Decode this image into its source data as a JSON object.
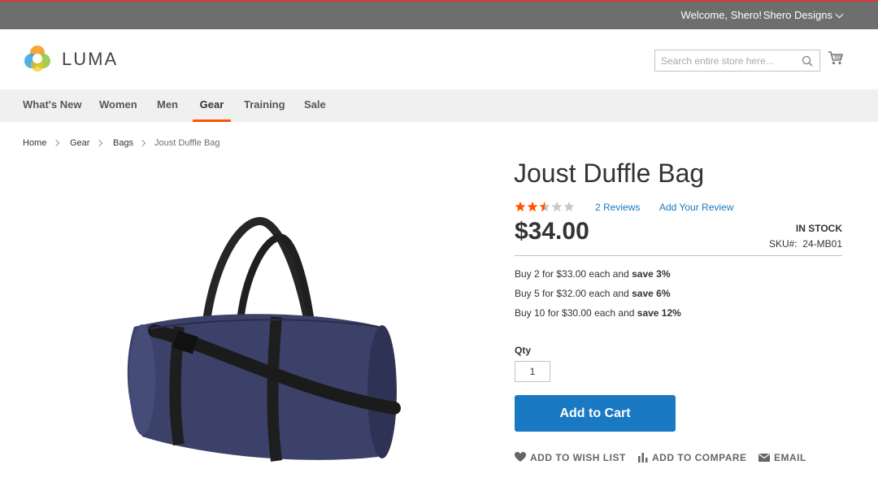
{
  "top_panel": {
    "welcome": "Welcome, Shero!",
    "account_name": "Shero Designs"
  },
  "header": {
    "logo_text": "LUMA",
    "search_placeholder": "Search entire store here...",
    "icons": [
      "search-icon",
      "cart-icon"
    ]
  },
  "nav": {
    "items": [
      {
        "label": "What's New"
      },
      {
        "label": "Women"
      },
      {
        "label": "Men"
      },
      {
        "label": "Gear",
        "active": true
      },
      {
        "label": "Training"
      },
      {
        "label": "Sale"
      }
    ]
  },
  "breadcrumb": [
    "Home",
    "Gear",
    "Bags",
    "Joust Duffle Bag"
  ],
  "product": {
    "name": "Joust Duffle Bag",
    "rating_stars": 2.5,
    "rating_max": 5,
    "reviews_label": "2 Reviews",
    "add_review_label": "Add Your Review",
    "price": "$34.00",
    "stock": "IN STOCK",
    "sku_label": "SKU#:",
    "sku": "24-MB01",
    "tier_prices": [
      {
        "text": "Buy 2 for $33.00 each and ",
        "save": "save 3%"
      },
      {
        "text": "Buy 5 for $32.00 each and ",
        "save": "save 6%"
      },
      {
        "text": "Buy 10 for $30.00 each and ",
        "save": "save 12%"
      }
    ],
    "qty_label": "Qty",
    "qty_value": "1",
    "add_to_cart_label": "Add to Cart",
    "actions": [
      {
        "label": "ADD TO WISH LIST",
        "icon": "heart-icon"
      },
      {
        "label": "ADD TO COMPARE",
        "icon": "compare-icon"
      },
      {
        "label": "EMAIL",
        "icon": "envelope-icon"
      }
    ]
  },
  "colors": {
    "top_bar": "#6e6e6e",
    "link": "#1979c3",
    "button": "#1979c3",
    "active_nav_underline": "#ff5501",
    "star_filled": "#ff5501",
    "star_empty": "#c7c7c7"
  }
}
